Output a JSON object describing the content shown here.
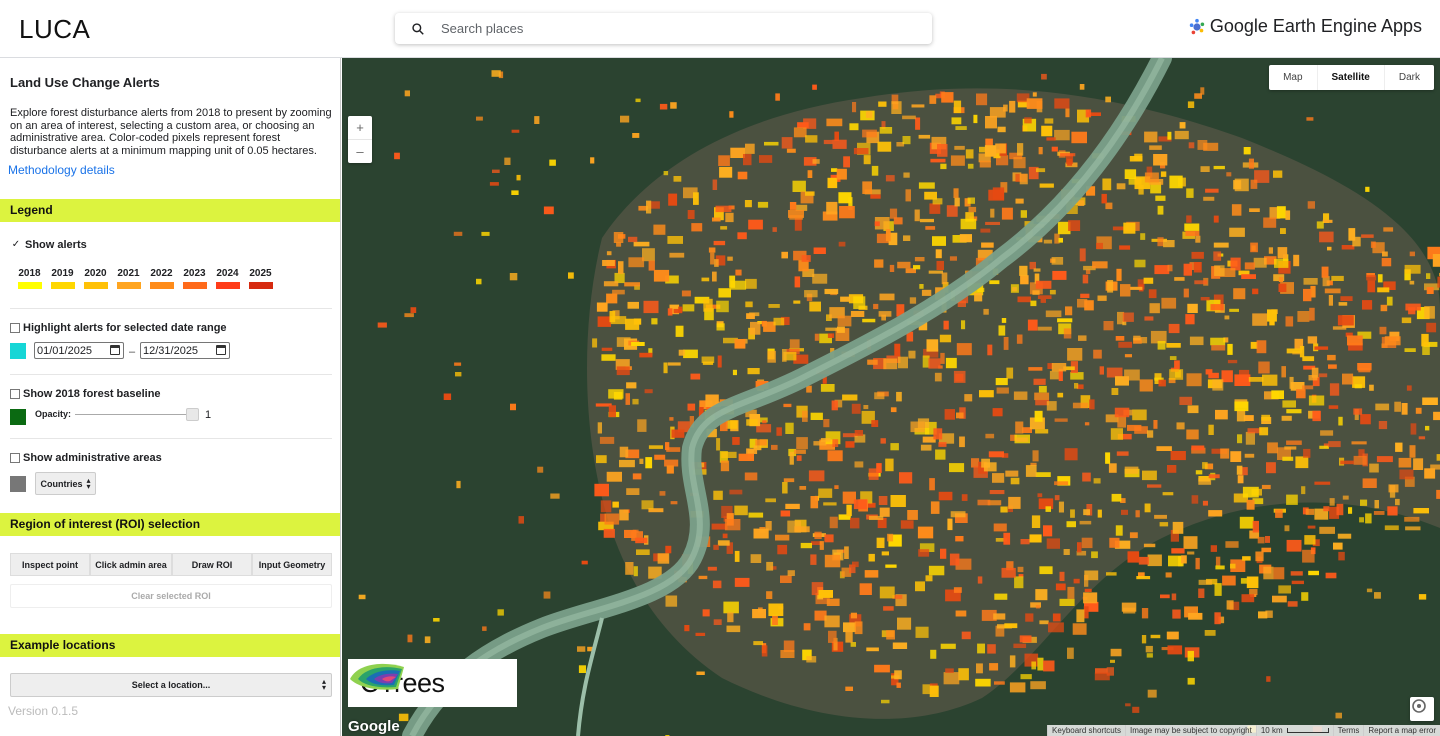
{
  "header": {
    "app_title": "LUCA",
    "search_placeholder": "Search places",
    "brand": "Google Earth Engine Apps"
  },
  "sidebar": {
    "title": "Land Use Change Alerts",
    "description": "Explore forest disturbance alerts from 2018 to present by zooming on an area of interest, selecting a custom area, or choosing an administrative area. Color-coded pixels represent forest disturbance alerts at a minimum mapping unit of 0.05 hectares.",
    "methodology_link": "Methodology details",
    "legend": {
      "heading": "Legend",
      "show_alerts_label": "Show alerts",
      "show_alerts_checked": true,
      "years": [
        {
          "label": "2018",
          "color": "#ffff00"
        },
        {
          "label": "2019",
          "color": "#ffd700"
        },
        {
          "label": "2020",
          "color": "#ffc107"
        },
        {
          "label": "2021",
          "color": "#ffa520"
        },
        {
          "label": "2022",
          "color": "#ff8c1a"
        },
        {
          "label": "2023",
          "color": "#ff6a1a"
        },
        {
          "label": "2024",
          "color": "#ff3c1a"
        },
        {
          "label": "2025",
          "color": "#d62a10"
        }
      ],
      "highlight_label": "Highlight alerts for selected date range",
      "highlight_color": "#16d6d6",
      "date_start": "01/01/2025",
      "date_separator": "–",
      "date_end": "12/31/2025",
      "baseline_label": "Show 2018 forest baseline",
      "baseline_color": "#0b6a12",
      "opacity_label": "Opacity:",
      "opacity_value": "1",
      "admin_label": "Show administrative areas",
      "admin_color": "#777777",
      "admin_select": "Countries"
    },
    "roi": {
      "heading": "Region of interest (ROI) selection",
      "buttons": [
        "Inspect point",
        "Click admin area",
        "Draw ROI",
        "Input Geometry"
      ],
      "clear": "Clear selected ROI"
    },
    "examples": {
      "heading": "Example locations",
      "select": "Select a location..."
    },
    "version": "Version 0.1.5"
  },
  "map": {
    "map_types": [
      "Map",
      "Satellite",
      "Dark"
    ],
    "active_type": "Satellite",
    "zoom_in": "+",
    "zoom_out": "–",
    "ctrees_label": "CTrees",
    "google_label": "Google",
    "attribution": {
      "shortcuts": "Keyboard shortcuts",
      "copyright": "Image may be subject to copyright",
      "scale": "10 km",
      "terms": "Terms",
      "report": "Report a map error"
    }
  }
}
